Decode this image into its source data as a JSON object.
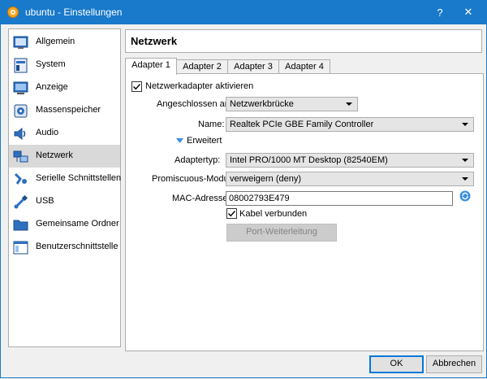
{
  "window": {
    "title": "ubuntu - Einstellungen",
    "help_label": "?",
    "close_label": "✕"
  },
  "sidebar": {
    "items": [
      {
        "label": "Allgemein",
        "icon": "general-icon"
      },
      {
        "label": "System",
        "icon": "system-icon"
      },
      {
        "label": "Anzeige",
        "icon": "display-icon"
      },
      {
        "label": "Massenspeicher",
        "icon": "storage-icon"
      },
      {
        "label": "Audio",
        "icon": "audio-icon"
      },
      {
        "label": "Netzwerk",
        "icon": "network-icon",
        "selected": true
      },
      {
        "label": "Serielle Schnittstellen",
        "icon": "serial-ports-icon"
      },
      {
        "label": "USB",
        "icon": "usb-icon"
      },
      {
        "label": "Gemeinsame Ordner",
        "icon": "shared-folders-icon"
      },
      {
        "label": "Benutzerschnittstelle",
        "icon": "user-interface-icon"
      }
    ]
  },
  "section": {
    "title": "Netzwerk"
  },
  "tabs": [
    {
      "label": "Adapter 1",
      "active": true
    },
    {
      "label": "Adapter 2"
    },
    {
      "label": "Adapter 3"
    },
    {
      "label": "Adapter 4"
    }
  ],
  "adapter": {
    "enable_label": "Netzwerkadapter aktivieren",
    "enabled": true,
    "attached_label": "Angeschlossen an:",
    "attached_value": "Netzwerkbrücke",
    "name_label": "Name:",
    "name_value": "Realtek PCIe GBE Family Controller",
    "advanced_label": "Erweitert",
    "adapter_type_label": "Adaptertyp:",
    "adapter_type_value": "Intel PRO/1000 MT Desktop (82540EM)",
    "promisc_label": "Promiscuous-Modus:",
    "promisc_value": "verweigern (deny)",
    "mac_label": "MAC-Adresse:",
    "mac_value": "08002793E479",
    "cable_label": "Kabel verbunden",
    "cable_connected": true,
    "port_forwarding_label": "Port-Weiterleitung"
  },
  "footer": {
    "ok_label": "OK",
    "cancel_label": "Abbrechen"
  },
  "colors": {
    "titlebar": "#1979ca",
    "selection": "#d9d9d9",
    "accent": "#0078d7"
  }
}
